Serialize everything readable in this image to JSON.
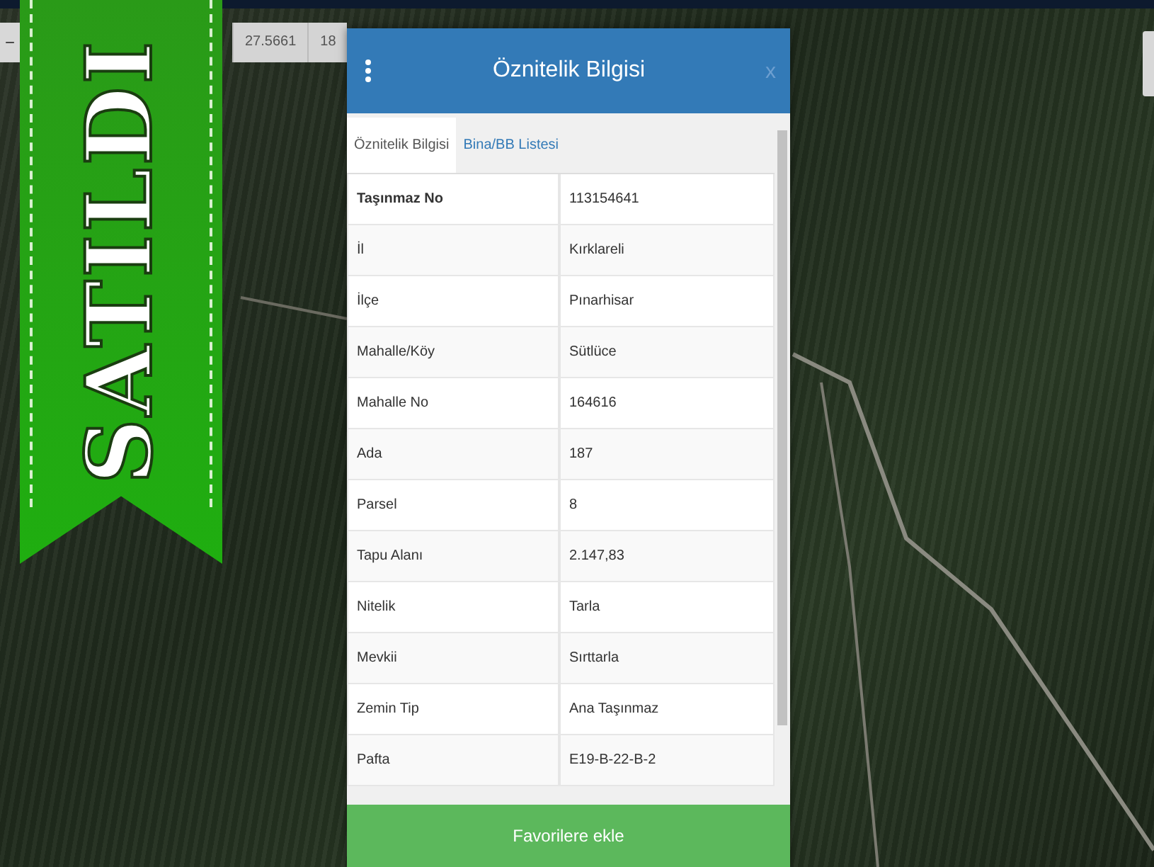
{
  "map_toolbar": {
    "zoom_out": "−",
    "coordinate": "27.5661",
    "zoom_level": "18"
  },
  "ribbon": {
    "text": "SATILDI"
  },
  "dialog": {
    "title": "Öznitelik Bilgisi",
    "close": "x",
    "tabs": [
      {
        "label": "Öznitelik Bilgisi",
        "selected": true
      },
      {
        "label": "Bina/BB Listesi",
        "selected": false
      }
    ],
    "rows": [
      {
        "label": "Taşınmaz No",
        "value": "113154641",
        "bold": true
      },
      {
        "label": "İl",
        "value": "Kırklareli",
        "bold": false
      },
      {
        "label": "İlçe",
        "value": "Pınarhisar",
        "bold": false
      },
      {
        "label": "Mahalle/Köy",
        "value": "Sütlüce",
        "bold": false
      },
      {
        "label": "Mahalle No",
        "value": "164616",
        "bold": false
      },
      {
        "label": "Ada",
        "value": "187",
        "bold": false
      },
      {
        "label": "Parsel",
        "value": "8",
        "bold": false
      },
      {
        "label": "Tapu Alanı",
        "value": "2.147,83",
        "bold": false
      },
      {
        "label": "Nitelik",
        "value": "Tarla",
        "bold": false
      },
      {
        "label": "Mevkii",
        "value": "Sırttarla",
        "bold": false
      },
      {
        "label": "Zemin Tip",
        "value": "Ana Taşınmaz",
        "bold": false
      },
      {
        "label": "Pafta",
        "value": "E19-B-22-B-2",
        "bold": false
      }
    ],
    "button": "Favorilere ekle"
  }
}
